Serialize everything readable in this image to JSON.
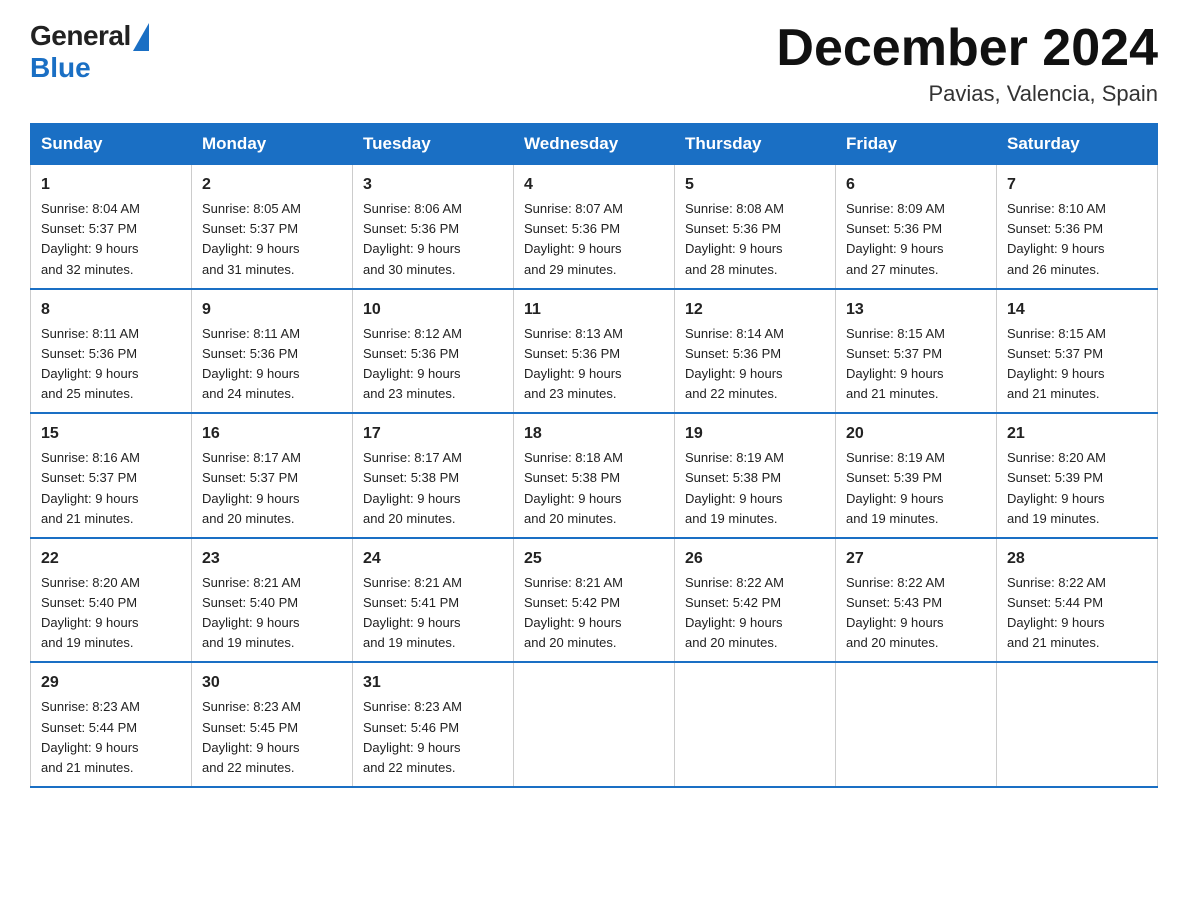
{
  "logo": {
    "general": "General",
    "blue": "Blue"
  },
  "title": {
    "month": "December 2024",
    "location": "Pavias, Valencia, Spain"
  },
  "days_of_week": [
    "Sunday",
    "Monday",
    "Tuesday",
    "Wednesday",
    "Thursday",
    "Friday",
    "Saturday"
  ],
  "weeks": [
    [
      {
        "day": "1",
        "sunrise": "8:04 AM",
        "sunset": "5:37 PM",
        "daylight": "9 hours and 32 minutes."
      },
      {
        "day": "2",
        "sunrise": "8:05 AM",
        "sunset": "5:37 PM",
        "daylight": "9 hours and 31 minutes."
      },
      {
        "day": "3",
        "sunrise": "8:06 AM",
        "sunset": "5:36 PM",
        "daylight": "9 hours and 30 minutes."
      },
      {
        "day": "4",
        "sunrise": "8:07 AM",
        "sunset": "5:36 PM",
        "daylight": "9 hours and 29 minutes."
      },
      {
        "day": "5",
        "sunrise": "8:08 AM",
        "sunset": "5:36 PM",
        "daylight": "9 hours and 28 minutes."
      },
      {
        "day": "6",
        "sunrise": "8:09 AM",
        "sunset": "5:36 PM",
        "daylight": "9 hours and 27 minutes."
      },
      {
        "day": "7",
        "sunrise": "8:10 AM",
        "sunset": "5:36 PM",
        "daylight": "9 hours and 26 minutes."
      }
    ],
    [
      {
        "day": "8",
        "sunrise": "8:11 AM",
        "sunset": "5:36 PM",
        "daylight": "9 hours and 25 minutes."
      },
      {
        "day": "9",
        "sunrise": "8:11 AM",
        "sunset": "5:36 PM",
        "daylight": "9 hours and 24 minutes."
      },
      {
        "day": "10",
        "sunrise": "8:12 AM",
        "sunset": "5:36 PM",
        "daylight": "9 hours and 23 minutes."
      },
      {
        "day": "11",
        "sunrise": "8:13 AM",
        "sunset": "5:36 PM",
        "daylight": "9 hours and 23 minutes."
      },
      {
        "day": "12",
        "sunrise": "8:14 AM",
        "sunset": "5:36 PM",
        "daylight": "9 hours and 22 minutes."
      },
      {
        "day": "13",
        "sunrise": "8:15 AM",
        "sunset": "5:37 PM",
        "daylight": "9 hours and 21 minutes."
      },
      {
        "day": "14",
        "sunrise": "8:15 AM",
        "sunset": "5:37 PM",
        "daylight": "9 hours and 21 minutes."
      }
    ],
    [
      {
        "day": "15",
        "sunrise": "8:16 AM",
        "sunset": "5:37 PM",
        "daylight": "9 hours and 21 minutes."
      },
      {
        "day": "16",
        "sunrise": "8:17 AM",
        "sunset": "5:37 PM",
        "daylight": "9 hours and 20 minutes."
      },
      {
        "day": "17",
        "sunrise": "8:17 AM",
        "sunset": "5:38 PM",
        "daylight": "9 hours and 20 minutes."
      },
      {
        "day": "18",
        "sunrise": "8:18 AM",
        "sunset": "5:38 PM",
        "daylight": "9 hours and 20 minutes."
      },
      {
        "day": "19",
        "sunrise": "8:19 AM",
        "sunset": "5:38 PM",
        "daylight": "9 hours and 19 minutes."
      },
      {
        "day": "20",
        "sunrise": "8:19 AM",
        "sunset": "5:39 PM",
        "daylight": "9 hours and 19 minutes."
      },
      {
        "day": "21",
        "sunrise": "8:20 AM",
        "sunset": "5:39 PM",
        "daylight": "9 hours and 19 minutes."
      }
    ],
    [
      {
        "day": "22",
        "sunrise": "8:20 AM",
        "sunset": "5:40 PM",
        "daylight": "9 hours and 19 minutes."
      },
      {
        "day": "23",
        "sunrise": "8:21 AM",
        "sunset": "5:40 PM",
        "daylight": "9 hours and 19 minutes."
      },
      {
        "day": "24",
        "sunrise": "8:21 AM",
        "sunset": "5:41 PM",
        "daylight": "9 hours and 19 minutes."
      },
      {
        "day": "25",
        "sunrise": "8:21 AM",
        "sunset": "5:42 PM",
        "daylight": "9 hours and 20 minutes."
      },
      {
        "day": "26",
        "sunrise": "8:22 AM",
        "sunset": "5:42 PM",
        "daylight": "9 hours and 20 minutes."
      },
      {
        "day": "27",
        "sunrise": "8:22 AM",
        "sunset": "5:43 PM",
        "daylight": "9 hours and 20 minutes."
      },
      {
        "day": "28",
        "sunrise": "8:22 AM",
        "sunset": "5:44 PM",
        "daylight": "9 hours and 21 minutes."
      }
    ],
    [
      {
        "day": "29",
        "sunrise": "8:23 AM",
        "sunset": "5:44 PM",
        "daylight": "9 hours and 21 minutes."
      },
      {
        "day": "30",
        "sunrise": "8:23 AM",
        "sunset": "5:45 PM",
        "daylight": "9 hours and 22 minutes."
      },
      {
        "day": "31",
        "sunrise": "8:23 AM",
        "sunset": "5:46 PM",
        "daylight": "9 hours and 22 minutes."
      },
      null,
      null,
      null,
      null
    ]
  ],
  "labels": {
    "sunrise": "Sunrise:",
    "sunset": "Sunset:",
    "daylight": "Daylight:"
  }
}
